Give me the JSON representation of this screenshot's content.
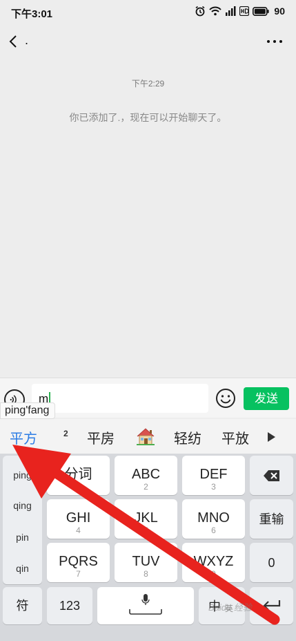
{
  "status": {
    "time": "下午3:01",
    "battery": "90"
  },
  "title": {
    "name": "."
  },
  "chat": {
    "time": "下午2:29",
    "system_message": "你已添加了.，现在可以开始聊天了。"
  },
  "input": {
    "text": "m",
    "send_label": "发送"
  },
  "pinyin_tip": "ping'fang",
  "candidates": {
    "first": "平方",
    "sup": "2",
    "items": [
      "平房",
      "轻纺",
      "平放"
    ]
  },
  "keyboard": {
    "side": [
      "ping",
      "qing",
      "pin",
      "qin"
    ],
    "keys": [
      {
        "main": "分词",
        "sub": ""
      },
      {
        "main": "ABC",
        "sub": "2"
      },
      {
        "main": "DEF",
        "sub": "3"
      },
      {
        "main": "GHI",
        "sub": "4"
      },
      {
        "main": "JKL",
        "sub": "5"
      },
      {
        "main": "MNO",
        "sub": "6"
      },
      {
        "main": "PQRS",
        "sub": "7"
      },
      {
        "main": "TUV",
        "sub": "8"
      },
      {
        "main": "WXYZ",
        "sub": "9"
      }
    ],
    "reinput": "重输",
    "zero": "0",
    "symbol": "符",
    "num": "123",
    "lang": "中",
    "lang_alt": "英"
  },
  "watermark": "Baidu 经验",
  "colors": {
    "accent": "#07c160",
    "arrow": "#e8231e",
    "candidate": "#2a7be4"
  }
}
